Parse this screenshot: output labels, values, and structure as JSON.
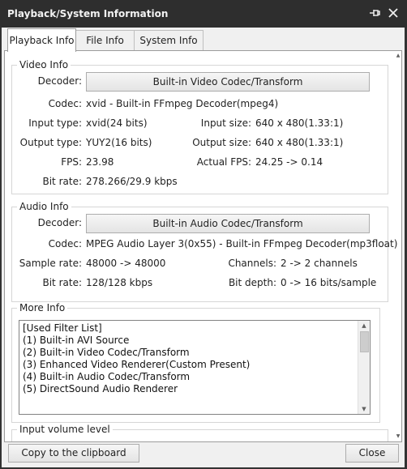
{
  "window": {
    "title": "Playback/System Information",
    "pin_icon": "pin-icon",
    "close_icon": "close-icon"
  },
  "tabs": [
    {
      "label": "Playback Info",
      "active": true
    },
    {
      "label": "File Info",
      "active": false
    },
    {
      "label": "System Info",
      "active": false
    }
  ],
  "video_info": {
    "title": "Video Info",
    "decoder_label": "Decoder:",
    "decoder_button": "Built-in Video Codec/Transform",
    "codec_label": "Codec:",
    "codec_value": "xvid - Built-in FFmpeg Decoder(mpeg4)",
    "input_type_label": "Input type:",
    "input_type_value": "xvid(24 bits)",
    "input_size_label": "Input size:",
    "input_size_value": "640 x 480(1.33:1)",
    "output_type_label": "Output type:",
    "output_type_value": "YUY2(16 bits)",
    "output_size_label": "Output size:",
    "output_size_value": "640 x 480(1.33:1)",
    "fps_label": "FPS:",
    "fps_value": "23.98",
    "actual_fps_label": "Actual FPS:",
    "actual_fps_value": "24.25 -> 0.14",
    "bitrate_label": "Bit rate:",
    "bitrate_value": "278.266/29.9 kbps"
  },
  "audio_info": {
    "title": "Audio Info",
    "decoder_label": "Decoder:",
    "decoder_button": "Built-in Audio Codec/Transform",
    "codec_label": "Codec:",
    "codec_value": "MPEG Audio Layer 3(0x55) - Built-in FFmpeg Decoder(mp3float)",
    "sample_rate_label": "Sample rate:",
    "sample_rate_value": "48000 -> 48000",
    "channels_label": "Channels:",
    "channels_value": "2 -> 2 channels",
    "bitrate_label": "Bit rate:",
    "bitrate_value": "128/128 kbps",
    "bit_depth_label": "Bit depth:",
    "bit_depth_value": "0 -> 16 bits/sample"
  },
  "more_info": {
    "title": "More Info",
    "lines": [
      "[Used Filter List]",
      "(1) Built-in AVI Source",
      "(2) Built-in Video Codec/Transform",
      "(3) Enhanced Video Renderer(Custom Present)",
      "(4) Built-in Audio Codec/Transform",
      "(5) DirectSound Audio Renderer"
    ]
  },
  "input_volume": {
    "title": "Input volume level"
  },
  "footer": {
    "copy_button": "Copy to the clipboard",
    "close_button": "Close"
  }
}
